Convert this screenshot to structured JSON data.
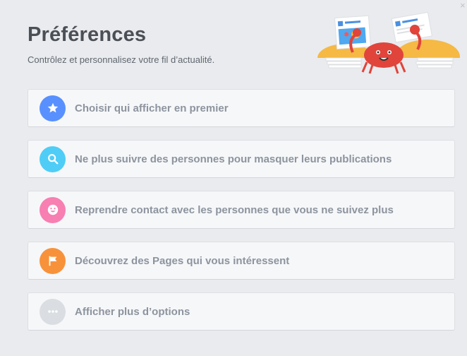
{
  "header": {
    "title": "Préférences",
    "subtitle": "Contrôlez et personnalisez votre fil d’actualité."
  },
  "items": [
    {
      "label": "Choisir qui afficher en premier",
      "icon": "star-icon",
      "color": "#5890ff"
    },
    {
      "label": "Ne plus suivre des personnes pour masquer leurs publications",
      "icon": "search-icon",
      "color": "#4fcdf7"
    },
    {
      "label": "Reprendre contact avec les personnes que vous ne suivez plus",
      "icon": "smiley-icon",
      "color": "#f77fb1"
    },
    {
      "label": "Découvrez des Pages qui vous intéressent",
      "icon": "flag-icon",
      "color": "#f7923b"
    },
    {
      "label": "Afficher plus d’options",
      "icon": "more-dots-icon",
      "color": "#dadde1"
    }
  ]
}
